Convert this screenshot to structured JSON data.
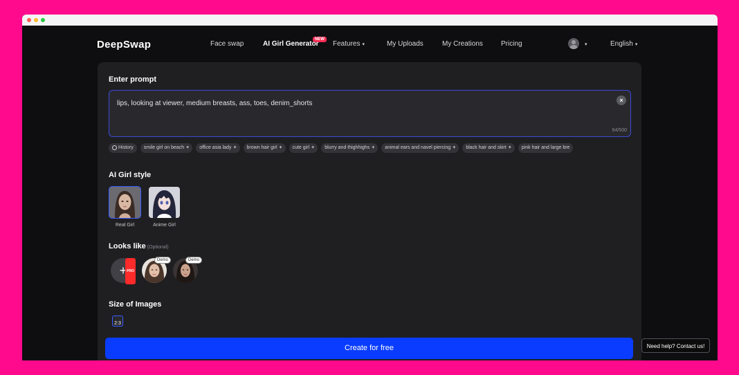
{
  "nav": {
    "logo": "DeepSwap",
    "items": [
      "Face swap",
      "AI Girl Generator",
      "Features",
      "My Uploads",
      "My Creations",
      "Pricing"
    ],
    "new_badge": "NEW",
    "language": "English"
  },
  "prompt": {
    "title": "Enter prompt",
    "value": "lips, looking at viewer, medium breasts, ass, toes, denim_shorts",
    "counter": "64/500",
    "clear_icon": "close-icon"
  },
  "chips": {
    "history": "History",
    "items": [
      "smile girl on beach",
      "office asia lady",
      "brown hair girl",
      "cute girl",
      "blurry and thighhighs",
      "animal ears and navel piercing",
      "black hair and skirt",
      "pink hair and large bre"
    ]
  },
  "style": {
    "title": "AI Girl style",
    "options": [
      "Real Girl",
      "Anime Girl"
    ],
    "selected": "Real Girl"
  },
  "looks": {
    "title": "Looks like",
    "optional": "(Optional)",
    "pro_badge": "PRO",
    "demo_label": "Demo"
  },
  "size": {
    "title": "Size of Images",
    "selected": "2:3"
  },
  "actions": {
    "create": "Create for free",
    "help": "Need help? Contact us!"
  },
  "colors": {
    "accent": "#0a3cff",
    "selection": "#3b5bff",
    "background": "#ff0a8c"
  }
}
